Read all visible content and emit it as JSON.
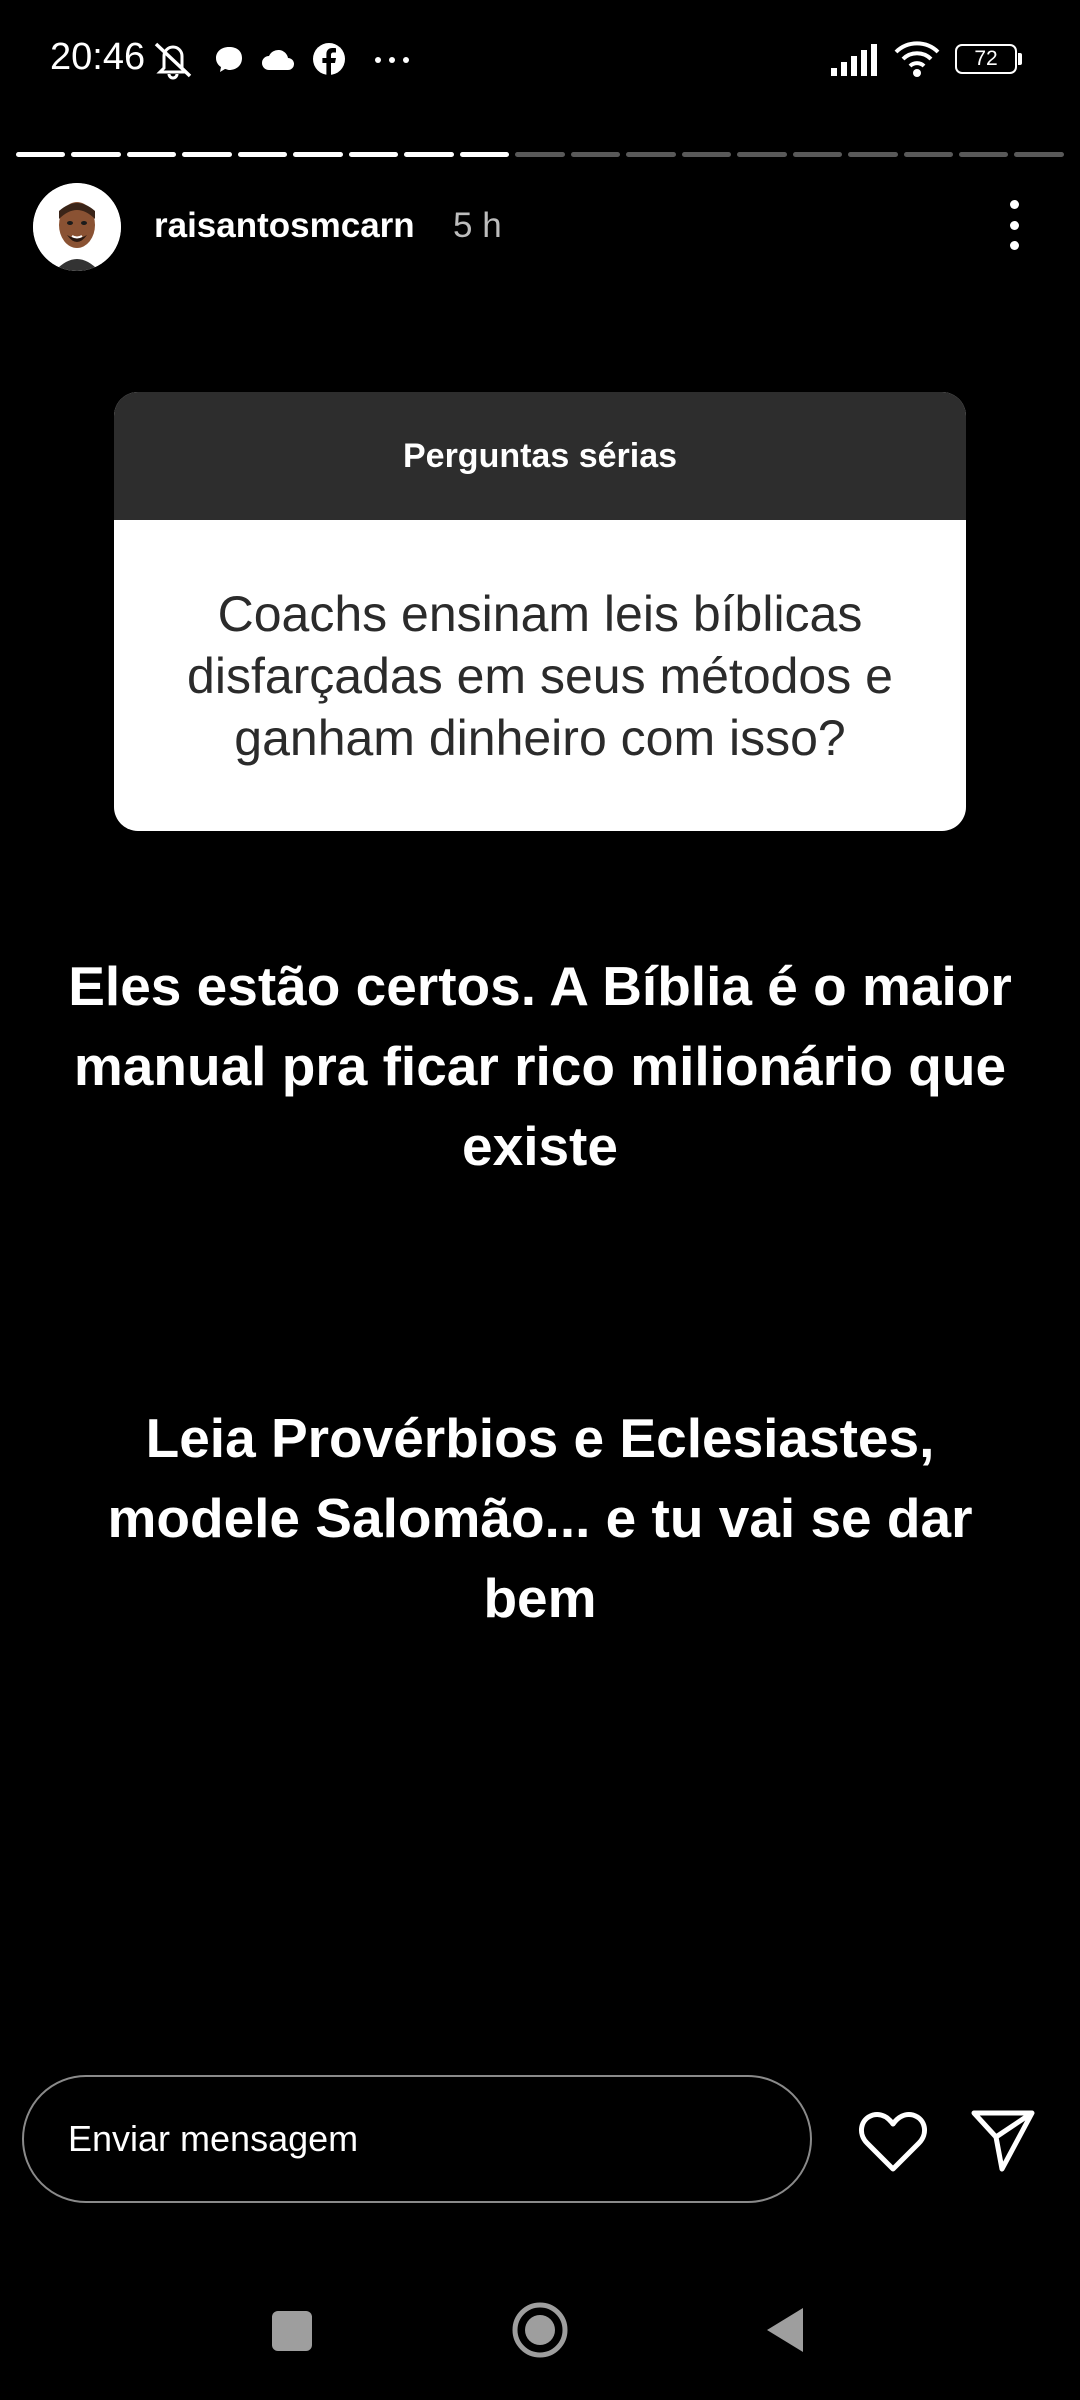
{
  "status_bar": {
    "time": "20:46",
    "battery": "72",
    "icons": [
      "mute-icon",
      "chat-icon",
      "cloud-icon",
      "facebook-icon",
      "more-dots-icon",
      "signal-icon",
      "wifi-icon",
      "battery-icon"
    ]
  },
  "story": {
    "progress_total": 19,
    "progress_seen": 9,
    "username": "raisantosmcarn",
    "time_ago": "5 h"
  },
  "question_box": {
    "title": "Perguntas sérias",
    "question": "Coachs ensinam leis bíblicas disfarçadas em seus métodos e ganham dinheiro com isso?"
  },
  "answer": {
    "paragraph1": "Eles estão certos. A Bíblia é o maior manual pra ficar rico milionário que existe",
    "paragraph2": "Leia Provérbios e Eclesiastes, modele Salomão... e tu vai se dar bem"
  },
  "reply": {
    "placeholder": "Enviar mensagem"
  },
  "colors": {
    "background": "#000000",
    "question_header": "#2d2d2d",
    "question_text": "#2b2b2b"
  }
}
